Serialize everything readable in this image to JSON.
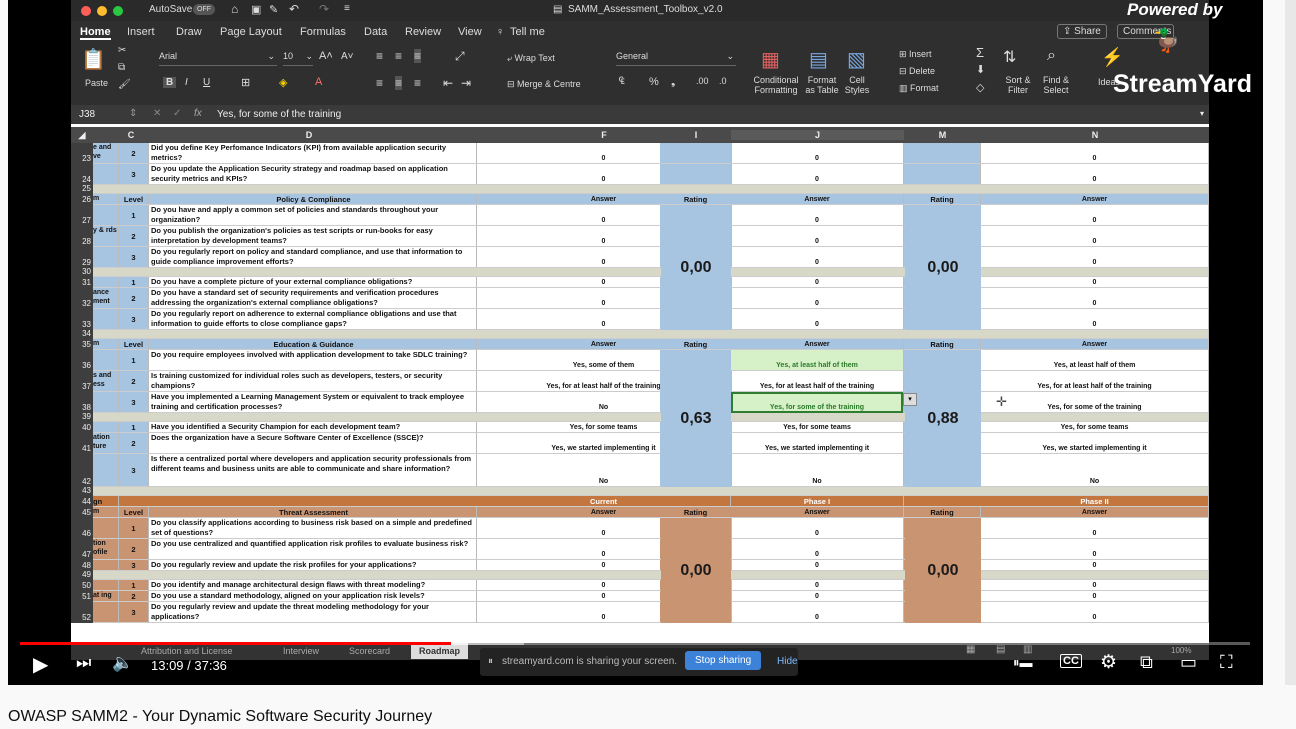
{
  "excel": {
    "autosave": "AutoSave",
    "autosave_state": "OFF",
    "file_title": "SAMM_Assessment_Toolbox_v2.0",
    "tabs": [
      "Home",
      "Insert",
      "Draw",
      "Page Layout",
      "Formulas",
      "Data",
      "Review",
      "View"
    ],
    "tell_me": "Tell me",
    "share": "Share",
    "comments": "Comments",
    "paste": "Paste",
    "font": "Arial",
    "font_size": "10",
    "wrap_text": "Wrap Text",
    "merge_centre": "Merge & Centre",
    "number_format": "General",
    "conditional_formatting": "Conditional Formatting",
    "format_as_table": "Format as Table",
    "cell_styles": "Cell Styles",
    "insert": "Insert",
    "delete": "Delete",
    "format": "Format",
    "sort_filter": "Sort & Filter",
    "find_select": "Find & Select",
    "ideas": "Ideas",
    "cell_ref": "J38",
    "formula": "Yes, for some of the training",
    "columns": [
      "C",
      "D",
      "F",
      "I",
      "J",
      "M",
      "N"
    ],
    "rows": [
      {
        "n": "23",
        "side": "e and ve",
        "level": "2",
        "q": "Did you define Key Perfomance Indicators (KPI) from available application security metrics?",
        "f": "0",
        "j": "0",
        "nv": "0"
      },
      {
        "n": "24",
        "level": "3",
        "q": "Do you update the Application Security strategy and roadmap based on application security metrics and KPIs?",
        "f": "0",
        "j": "0",
        "nv": "0"
      },
      {
        "n": "25"
      },
      {
        "n": "26",
        "side": "m",
        "level": "Level",
        "q": "Policy & Compliance",
        "f": "Answer",
        "i": "Rating",
        "j": "Answer",
        "m": "Rating",
        "nv": "Answer"
      },
      {
        "n": "27",
        "level": "1",
        "q": "Do you have and apply a common set of policies and standards throughout your organization?",
        "f": "0",
        "j": "0",
        "nv": "0"
      },
      {
        "n": "28",
        "side": "y & rds",
        "level": "2",
        "q": "Do you publish the organization's policies as test scripts or run-books for easy interpretation by development teams?",
        "f": "0",
        "j": "0",
        "nv": "0"
      },
      {
        "n": "29",
        "level": "3",
        "q": "Do you regularly report on policy and standard compliance, and use that information to guide compliance improvement efforts?",
        "f": "0",
        "j": "0",
        "nv": "0"
      },
      {
        "n": "30"
      },
      {
        "n": "31",
        "level": "1",
        "q": "Do you have a complete picture of your external compliance obligations?",
        "f": "0",
        "j": "0",
        "nv": "0"
      },
      {
        "n": "32",
        "side": "ance ment",
        "level": "2",
        "q": "Do you have a standard set of security requirements and verification procedures addressing the organization's external compliance obligations?",
        "f": "0",
        "j": "0",
        "nv": "0"
      },
      {
        "n": "33",
        "level": "3",
        "q": "Do you regularly report on adherence to external compliance obligations and use that information to guide efforts to close compliance gaps?",
        "f": "0",
        "j": "0",
        "nv": "0"
      },
      {
        "n": "34"
      },
      {
        "n": "35",
        "side": "m",
        "level": "Level",
        "q": "Education & Guidance",
        "f": "Answer",
        "i": "Rating",
        "j": "Answer",
        "m": "Rating",
        "nv": "Answer"
      },
      {
        "n": "36",
        "level": "1",
        "q": "Do you require employees involved with application development to take SDLC training?",
        "f": "Yes, some of them",
        "j": "Yes, at least half of them",
        "nv": "Yes, at least half of them"
      },
      {
        "n": "37",
        "side": "s and ess",
        "level": "2",
        "q": "Is training customized for individual roles such as developers, testers, or security champions?",
        "f": "Yes, for at least half of the training",
        "j": "Yes, for at least half of the training",
        "nv": "Yes, for at least half of the training"
      },
      {
        "n": "38",
        "level": "3",
        "q": "Have you implemented a Learning Management System or equivalent to track employee training and certification processes?",
        "f": "No",
        "j": "Yes, for some of the training",
        "nv": "Yes, for some of the training"
      },
      {
        "n": "39"
      },
      {
        "n": "40",
        "level": "1",
        "q": "Have you identified a Security Champion for each development team?",
        "f": "Yes, for some teams",
        "j": "Yes, for some teams",
        "nv": "Yes, for some teams"
      },
      {
        "n": "41",
        "side": "ation ture",
        "level": "2",
        "q": "Does the organization have a Secure Software Center of Excellence (SSCE)?",
        "f": "Yes, we started implementing it",
        "j": "Yes, we started implementing it",
        "nv": "Yes, we started implementing it"
      },
      {
        "n": "42",
        "level": "3",
        "q": "Is there a centralized portal where developers and application security professionals from different teams and business units are able to communicate and share information?",
        "f": "No",
        "j": "No",
        "nv": "No"
      },
      {
        "n": "43"
      },
      {
        "n": "44",
        "side": "gn",
        "f": "Current",
        "j": "Phase I",
        "nv": "Phase II"
      },
      {
        "n": "45",
        "side": "m",
        "level": "Level",
        "q": "Threat Assessment",
        "f": "Answer",
        "i": "Rating",
        "j": "Answer",
        "m": "Rating",
        "nv": "Answer"
      },
      {
        "n": "46",
        "level": "1",
        "q": "Do you classify applications according to business risk based on a simple and predefined set of questions?",
        "f": "0",
        "j": "0",
        "nv": "0"
      },
      {
        "n": "47",
        "side": "tion ofile",
        "level": "2",
        "q": "Do you use centralized and quantified application risk profiles to evaluate business risk?",
        "f": "0",
        "j": "0",
        "nv": "0"
      },
      {
        "n": "48",
        "level": "3",
        "q": "Do you regularly review and update the risk profiles for your applications?",
        "f": "0",
        "j": "0",
        "nv": "0"
      },
      {
        "n": "49"
      },
      {
        "n": "50",
        "level": "1",
        "q": "Do you identify and manage architectural design flaws with threat modeling?",
        "f": "0",
        "j": "0",
        "nv": "0"
      },
      {
        "n": "51",
        "side": "at ing",
        "level": "2",
        "q": "Do you use a standard methodology, aligned on your application risk levels?",
        "f": "0",
        "j": "0",
        "nv": "0"
      },
      {
        "n": "52",
        "level": "3",
        "q": "Do you regularly review and update the threat modeling methodology for your applications?",
        "f": "0",
        "j": "0",
        "nv": "0"
      }
    ],
    "ratings": {
      "policy_current": "0,00",
      "policy_phase1": "0,00",
      "edu_current": "0,63",
      "edu_phase1": "0,88",
      "threat_current": "0,00",
      "threat_phase1": "0,00"
    },
    "sheet_tabs": [
      "Attribution and License",
      "Interview",
      "Scorecard",
      "Roadmap"
    ],
    "zoom": "100%"
  },
  "screenshare": {
    "text": "streamyard.com is sharing your screen.",
    "stop": "Stop sharing",
    "hide": "Hide"
  },
  "branding": {
    "powered_by": "Powered by",
    "name": "StreamYard"
  },
  "player": {
    "time": "13:09 / 37:36",
    "progress": 0.35,
    "buffer": 0.41
  },
  "video_title": "OWASP SAMM2 - Your Dynamic Software Security Journey",
  "colors": {
    "blue": "#a7c4e0",
    "brown": "#c99472",
    "progress": "#ff0000"
  }
}
